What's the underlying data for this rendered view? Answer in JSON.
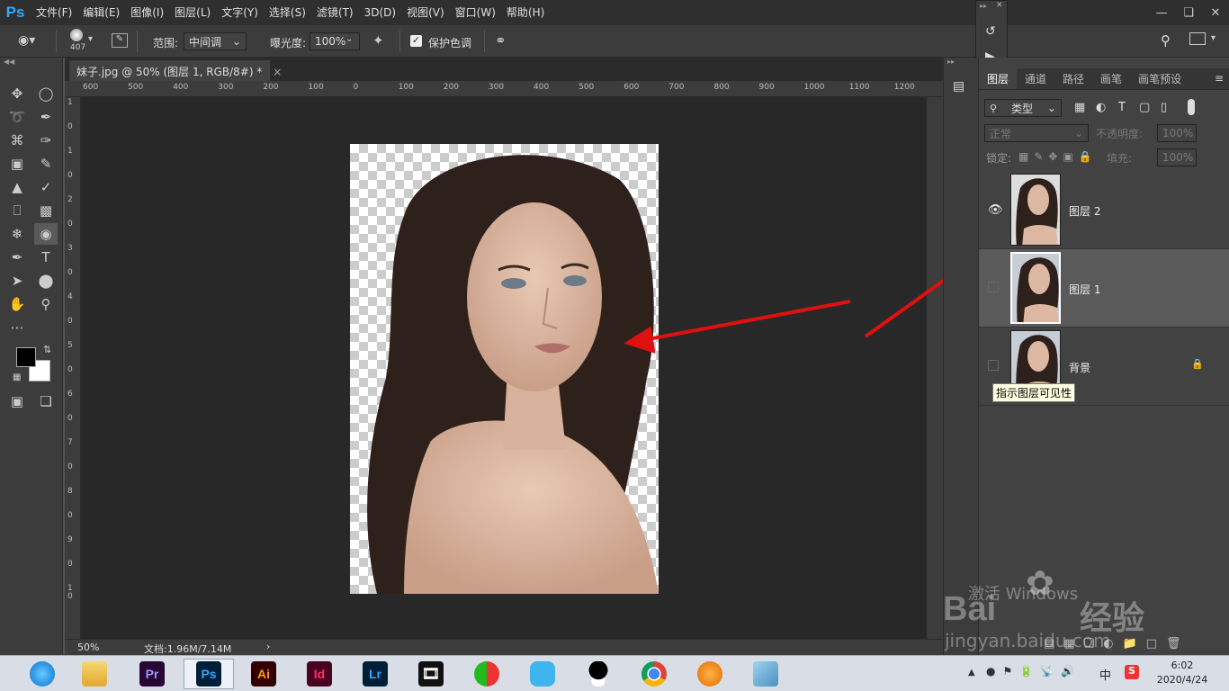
{
  "app": {
    "logo": "Ps"
  },
  "menu": [
    "文件(F)",
    "编辑(E)",
    "图像(I)",
    "图层(L)",
    "文字(Y)",
    "选择(S)",
    "滤镜(T)",
    "3D(D)",
    "视图(V)",
    "窗口(W)",
    "帮助(H)"
  ],
  "options": {
    "brush_size": "407",
    "range_label": "范围:",
    "range_value": "中间调",
    "exposure_label": "曝光度:",
    "exposure_value": "100%",
    "protect_tones_label": "保护色调",
    "protect_tones_checked": true
  },
  "document": {
    "tab_title": "妹子.jpg @ 50% (图层 1, RGB/8#) *",
    "zoom": "50%",
    "doc_info": "文档:1.96M/7.14M",
    "ruler_top": [
      "600",
      "500",
      "400",
      "300",
      "200",
      "100",
      "0",
      "100",
      "200",
      "300",
      "400",
      "500",
      "600",
      "700",
      "800",
      "900",
      "1000",
      "1100",
      "1200"
    ],
    "ruler_left": [
      "1",
      "0",
      "1",
      "0",
      "2",
      "0",
      "3",
      "0",
      "4",
      "0",
      "5",
      "0",
      "6",
      "0",
      "7",
      "0",
      "8",
      "0",
      "9",
      "0",
      "1 0"
    ]
  },
  "layers_panel": {
    "tabs": [
      "图层",
      "通道",
      "路径",
      "画笔",
      "画笔预设"
    ],
    "filter_label": "类型",
    "blend_mode": "正常",
    "opacity_label": "不透明度:",
    "opacity_value": "100%",
    "lock_label": "锁定:",
    "fill_label": "填充:",
    "fill_value": "100%",
    "layers": [
      {
        "name": "图层 2",
        "visible": true,
        "selected": false,
        "locked": false
      },
      {
        "name": "图层 1",
        "visible": false,
        "selected": true,
        "locked": false
      },
      {
        "name": "背景",
        "visible": false,
        "selected": false,
        "locked": true
      }
    ],
    "tooltip": "指示图层可见性"
  },
  "watermark": {
    "activate_windows": "激活 Windows",
    "baidu_brand": "Bai",
    "baidu_jingyan": "经验",
    "url": "jingyan.baidu.com"
  },
  "taskbar": {
    "apps": [
      {
        "name": "browser-360",
        "label": ""
      },
      {
        "name": "file-explorer",
        "label": ""
      },
      {
        "name": "premiere",
        "label": "Pr",
        "color": "#9999ff",
        "bg": "#2a0634"
      },
      {
        "name": "photoshop",
        "label": "Ps",
        "color": "#31a8ff",
        "bg": "#001e36"
      },
      {
        "name": "illustrator",
        "label": "Ai",
        "color": "#ff9a00",
        "bg": "#330000"
      },
      {
        "name": "indesign",
        "label": "Id",
        "color": "#ff3366",
        "bg": "#49021f"
      },
      {
        "name": "lightroom",
        "label": "Lr",
        "color": "#31a8ff",
        "bg": "#001e36"
      },
      {
        "name": "video-editor",
        "label": ""
      },
      {
        "name": "app-green-red",
        "label": ""
      },
      {
        "name": "app-blue",
        "label": ""
      },
      {
        "name": "qq",
        "label": ""
      },
      {
        "name": "chrome",
        "label": ""
      },
      {
        "name": "app-orange",
        "label": ""
      },
      {
        "name": "notepad",
        "label": ""
      }
    ],
    "time": "6:02",
    "date": "2020/4/24",
    "ime": "中"
  },
  "colors": {
    "accent": "#31a8ff",
    "arrow": "#e01010"
  }
}
